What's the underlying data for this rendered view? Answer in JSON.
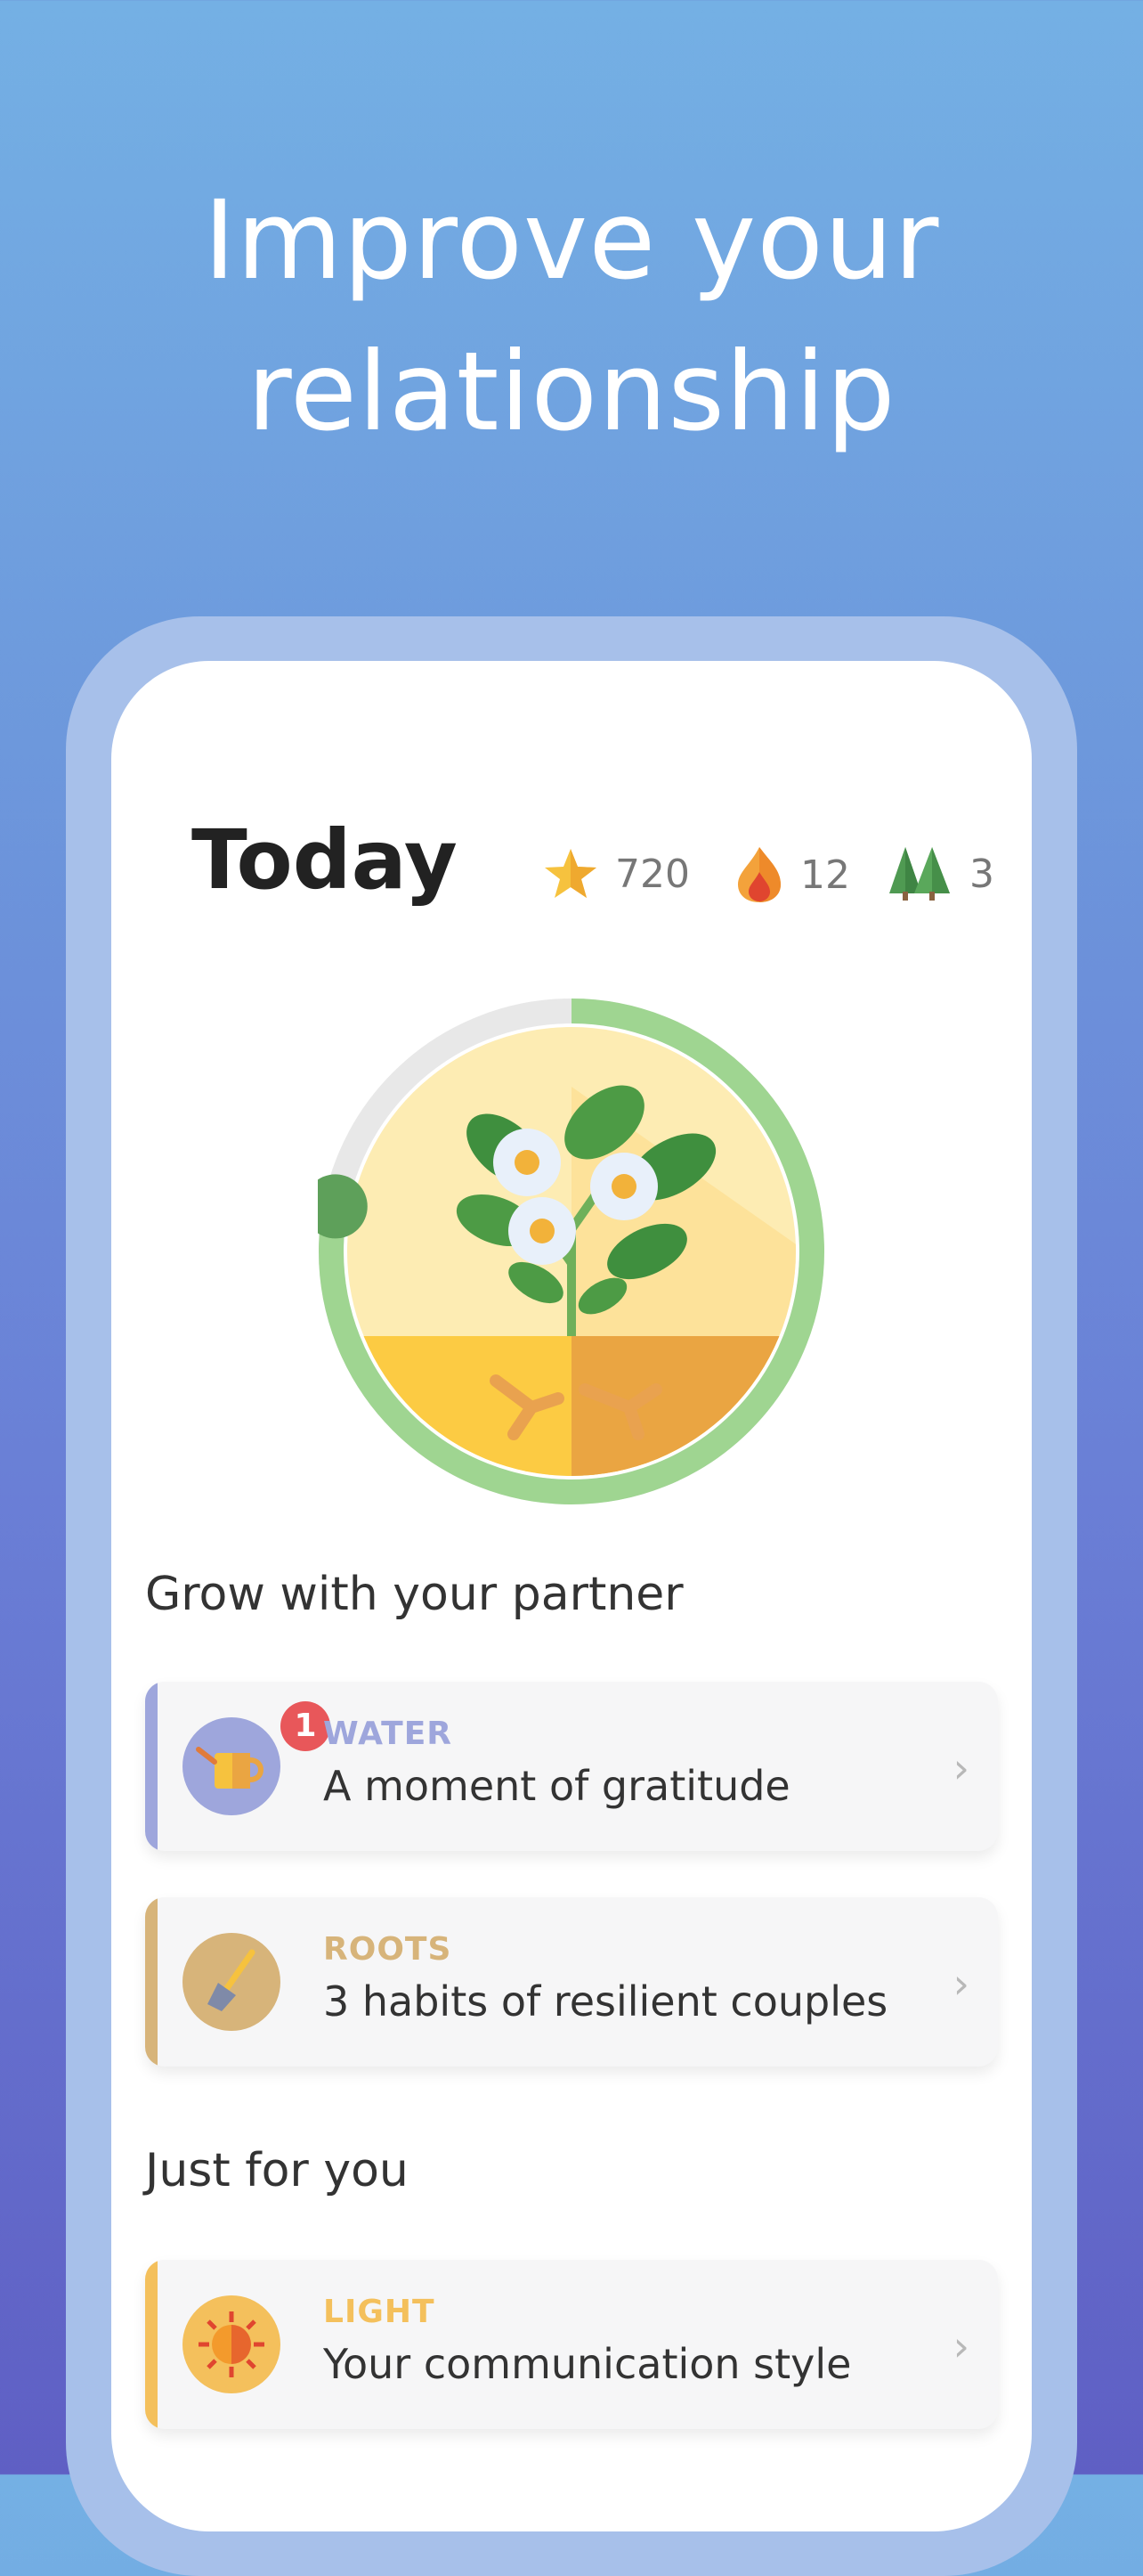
{
  "headline": {
    "line1": "Improve your",
    "line2": "relationship"
  },
  "screen": {
    "title": "Today",
    "stats": [
      {
        "icon": "star-icon",
        "value": "720"
      },
      {
        "icon": "flame-icon",
        "value": "12"
      },
      {
        "icon": "trees-icon",
        "value": "3"
      }
    ],
    "plant": {
      "progress_fraction": 0.78
    },
    "sections": [
      {
        "title": "Grow with your partner",
        "cards": [
          {
            "category": "WATER",
            "title": "A moment of gratitude",
            "badge": "1",
            "accent": "#9ea6dc",
            "icon": "watering-can-icon"
          },
          {
            "category": "ROOTS",
            "title": "3 habits of resilient couples",
            "accent": "#d7b47a",
            "icon": "shovel-icon"
          }
        ]
      },
      {
        "title": "Just for you",
        "cards": [
          {
            "category": "LIGHT",
            "title": "Your communication style",
            "accent": "#f4c05c",
            "icon": "sun-icon"
          }
        ]
      }
    ]
  },
  "colors": {
    "water": "#9ea6dc",
    "roots": "#d7b47a",
    "light": "#f4c05c",
    "progress_ring": "#9fd591",
    "progress_knob": "#5ea05a"
  }
}
